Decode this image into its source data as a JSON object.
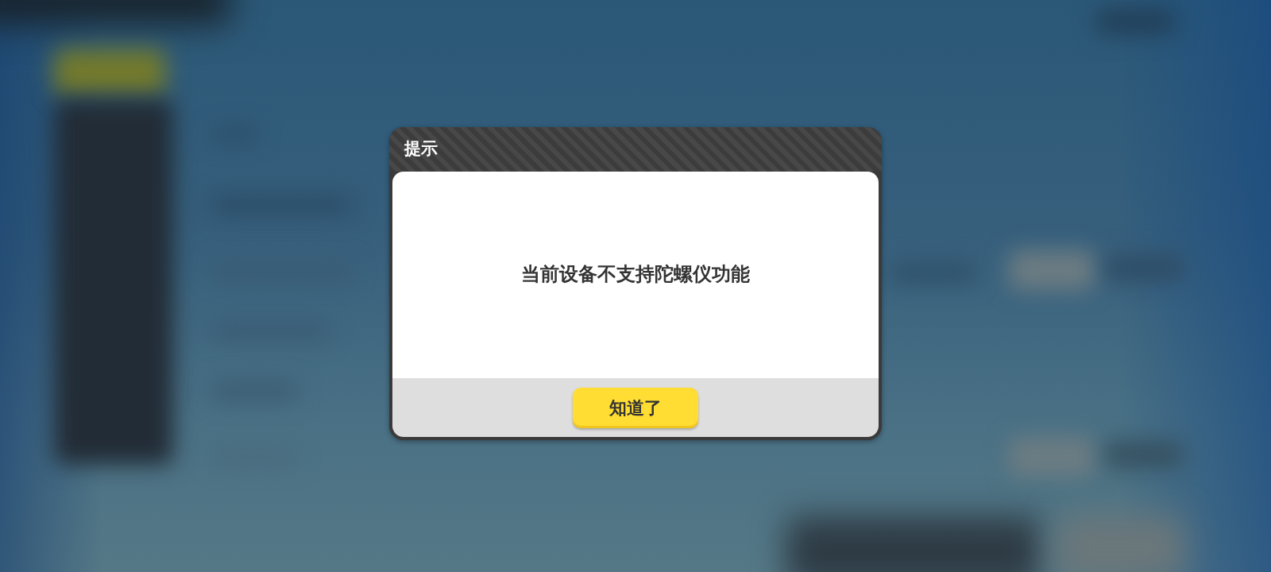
{
  "dialog": {
    "title": "提示",
    "message": "当前设备不支持陀螺仪功能",
    "buttons": [
      {
        "label": "知道了"
      }
    ]
  }
}
